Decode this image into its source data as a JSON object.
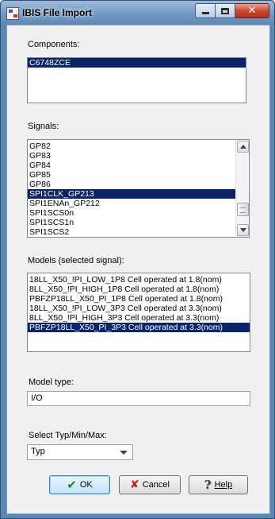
{
  "window": {
    "title": "IBIS File Import",
    "min_glyph": "—",
    "max_glyph": "☐",
    "close_glyph": "✕"
  },
  "components": {
    "label": "Components:",
    "items": [
      "C6748ZCE"
    ],
    "selected_index": 0
  },
  "signals": {
    "label": "Signals:",
    "items": [
      "GP82",
      "GP83",
      "GP84",
      "GP85",
      "GP86",
      "SPI1CLK_GP213",
      "SPI1ENAn_GP212",
      "SPI1SCS0n",
      "SPI1SCS1n",
      "SPI1SCS2"
    ],
    "selected_index": 5
  },
  "models": {
    "label": "Models (selected signal):",
    "items": [
      "18LL_X50_!PI_LOW_1P8 Cell operated at 1.8(nom)",
      "8LL_X50_!PI_HIGH_1P8 Cell operated at 1.8(nom)",
      "PBFZP18LL_X50_PI_1P8 Cell operated at 1.8(nom)",
      "18LL_X50_!PI_LOW_3P3 Cell operated at 3.3(nom)",
      "8LL_X50_!PI_HIGH_3P3 Cell operated at 3.3(nom)",
      "PBFZP18LL_X50_PI_3P3 Cell operated at 3.3(nom)"
    ],
    "selected_index": 5
  },
  "model_type": {
    "label": "Model type:",
    "value": "I/O"
  },
  "typ_select": {
    "label": "Select Typ/Min/Max:",
    "value": "Typ"
  },
  "buttons": {
    "ok": "OK",
    "cancel": "Cancel",
    "help": "Help"
  },
  "icons": {
    "ok": "check-icon",
    "cancel": "x-icon",
    "help": "question-icon"
  },
  "colors": {
    "selection": "#0a246a",
    "titlebar": "#6f97c0"
  }
}
